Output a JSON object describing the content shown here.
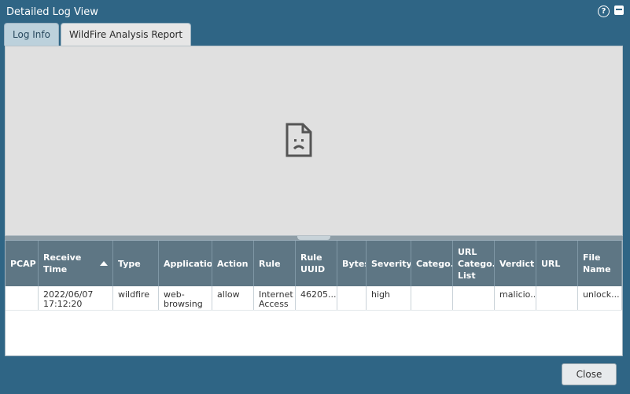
{
  "window": {
    "title": "Detailed Log View"
  },
  "icons": {
    "help": "help-icon",
    "maximize": "maximize-icon",
    "broken_document": "broken-document-icon",
    "sort_ascending": "sort-ascending-icon"
  },
  "tabs": [
    {
      "label": "Log Info",
      "active": false
    },
    {
      "label": "WildFire Analysis Report",
      "active": true
    }
  ],
  "table": {
    "columns": [
      "PCAP",
      "Receive Time",
      "Type",
      "Application",
      "Action",
      "Rule",
      "Rule UUID",
      "Bytes",
      "Severity",
      "Catego...",
      "URL Catego... List",
      "Verdict",
      "URL",
      "File Name"
    ],
    "rows": [
      {
        "pcap": "",
        "receive_time": "2022/06/07 17:12:20",
        "type": "wildfire",
        "application": "web-browsing",
        "action": "allow",
        "rule": "Internet Access",
        "rule_uuid": "46205...",
        "bytes": "",
        "severity": "high",
        "category": "",
        "url_category_list": "",
        "verdict": "malicio...",
        "url": "",
        "file_name": "unlock..."
      }
    ]
  },
  "footer": {
    "close_label": "Close"
  },
  "colors": {
    "header_bg": "#2f6585",
    "grid_header": "#5e7684"
  }
}
